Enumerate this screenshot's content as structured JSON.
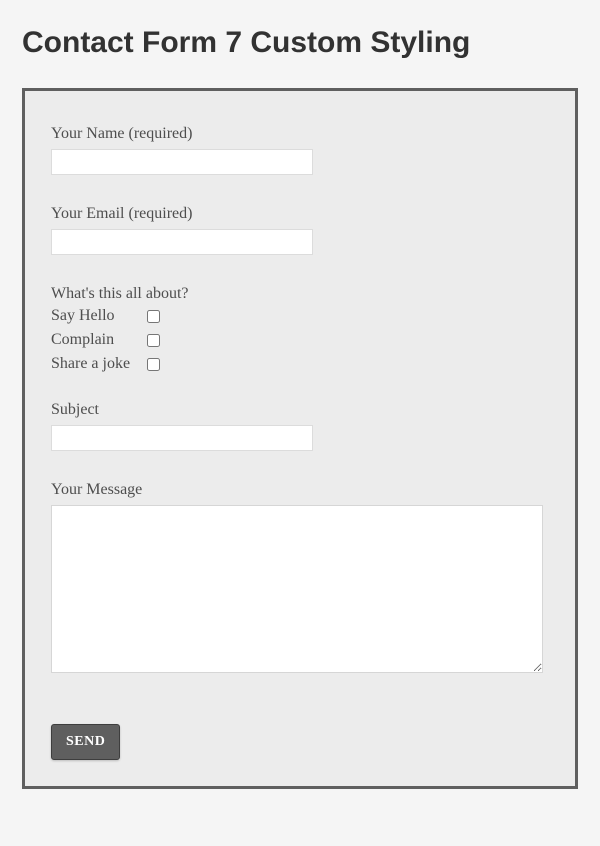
{
  "page": {
    "title": "Contact Form 7 Custom Styling"
  },
  "form": {
    "name_label": "Your Name (required)",
    "email_label": "Your Email (required)",
    "about_heading": "What's this all about?",
    "options": [
      {
        "label": "Say Hello"
      },
      {
        "label": "Complain"
      },
      {
        "label": "Share a joke"
      }
    ],
    "subject_label": "Subject",
    "message_label": "Your Message",
    "send_label": "SEND"
  }
}
